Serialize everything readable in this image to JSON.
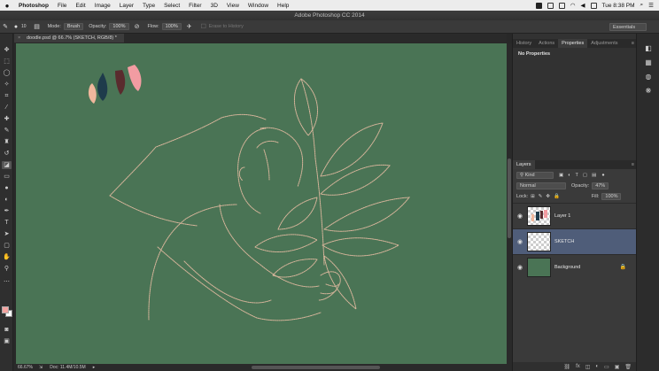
{
  "menubar": {
    "apple": "",
    "items": [
      "Photoshop",
      "File",
      "Edit",
      "Image",
      "Layer",
      "Type",
      "Select",
      "Filter",
      "3D",
      "View",
      "Window",
      "Help"
    ],
    "clock": "Tue 8:38 PM"
  },
  "window": {
    "title": "Adobe Photoshop CC 2014"
  },
  "options": {
    "brush_size": "10",
    "mode_label": "Mode:",
    "mode_value": "Brush",
    "opacity_label": "Opacity:",
    "opacity_value": "100%",
    "flow_label": "Flow:",
    "flow_value": "100%",
    "erase_history": "Erase to History",
    "workspace": "Essentials"
  },
  "document": {
    "tab": "doodle.psd @ 66.7% (SKETCH, RGB/8) *",
    "zoom": "66.67%",
    "doc_size": "Doc: 11.4M/10.5M"
  },
  "colors": {
    "canvas": "#4a7455",
    "foreground": "#f4a3a0",
    "background": "#ffffff",
    "line": "#d7b59b",
    "swatches": [
      "#f0b79c",
      "#1e3b4b",
      "#5a2b2e",
      "#f29ca2"
    ]
  },
  "properties_panel": {
    "tabs": [
      "History",
      "Actions",
      "Properties",
      "Adjustments"
    ],
    "active_tab": "Properties",
    "message": "No Properties"
  },
  "layers_panel": {
    "title": "Layers",
    "filter": "Kind",
    "blend_mode": "Normal",
    "opacity_label": "Opacity:",
    "opacity_value": "47%",
    "lock_label": "Lock:",
    "fill_label": "Fill:",
    "fill_value": "100%",
    "layers": [
      {
        "name": "Layer 1",
        "selected": false,
        "locked": false
      },
      {
        "name": "SKETCH",
        "selected": true,
        "locked": false
      },
      {
        "name": "Background",
        "selected": false,
        "locked": true
      }
    ]
  },
  "icons": {
    "visibility": "eye-icon",
    "lock": "lock-icon",
    "tools": [
      "move-icon",
      "marquee-icon",
      "lasso-icon",
      "quick-select-icon",
      "crop-icon",
      "eyedropper-icon",
      "healing-icon",
      "brush-icon",
      "stamp-icon",
      "history-brush-icon",
      "eraser-icon",
      "gradient-icon",
      "blur-icon",
      "dodge-icon",
      "pen-icon",
      "type-icon",
      "path-select-icon",
      "shape-icon",
      "hand-icon",
      "zoom-icon"
    ]
  }
}
